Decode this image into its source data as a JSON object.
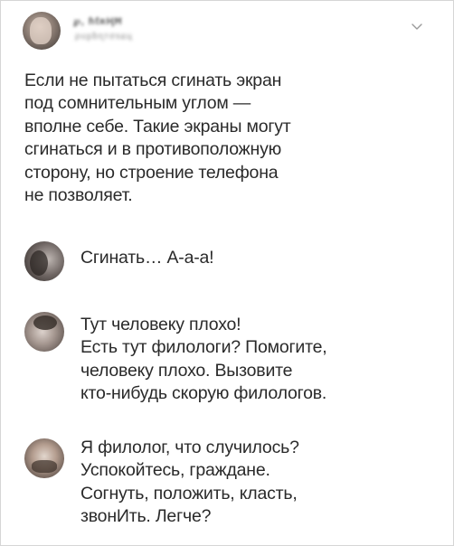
{
  "tweet": {
    "author_name": "℘, ɦƭʀҢĦ",
    "author_handle": "ρυʂɓɳтσѕɕц",
    "text_lines": [
      "Если не пытаться сгинать экран",
      "под сомнительным углом —",
      "вполне себе. Такие экраны могут",
      "сгинаться и в противоположную",
      "сторону, но строение телефона",
      "не позволяет."
    ]
  },
  "replies": [
    {
      "lines": [
        "Сгинать… А-а-а!"
      ]
    },
    {
      "lines": [
        "Тут человеку плохо!",
        "Есть тут филологи? Помогите,",
        "человеку плохо. Вызовите",
        "кто-нибудь скорую филологов."
      ]
    },
    {
      "lines": [
        "Я филолог, что случилось?",
        "Успокойтесь, граждане.",
        "Согнуть, положить, класть,",
        "звонИть. Легче?"
      ]
    }
  ],
  "icons": {
    "menu": "chevron-down-icon"
  },
  "colors": {
    "text": "#2a2a2a",
    "chevron": "#9a9a9a",
    "border": "#d6d6d6"
  }
}
